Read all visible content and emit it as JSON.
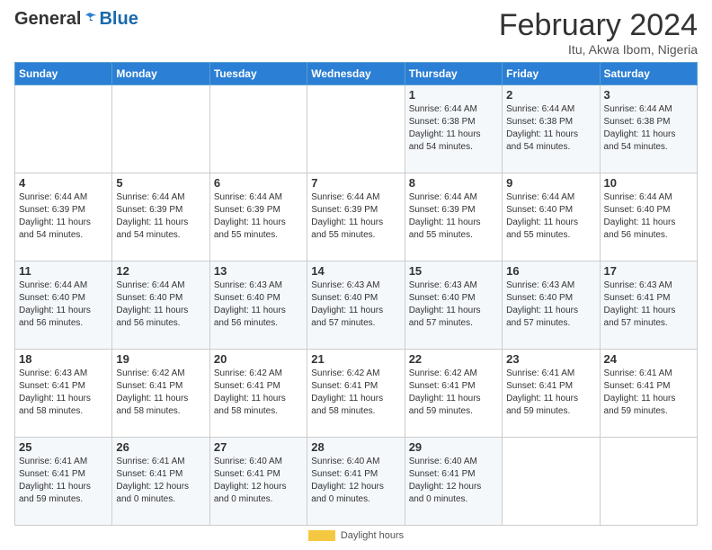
{
  "header": {
    "logo_general": "General",
    "logo_blue": "Blue",
    "month_title": "February 2024",
    "subtitle": "Itu, Akwa Ibom, Nigeria"
  },
  "days_of_week": [
    "Sunday",
    "Monday",
    "Tuesday",
    "Wednesday",
    "Thursday",
    "Friday",
    "Saturday"
  ],
  "weeks": [
    [
      {
        "day": "",
        "info": ""
      },
      {
        "day": "",
        "info": ""
      },
      {
        "day": "",
        "info": ""
      },
      {
        "day": "",
        "info": ""
      },
      {
        "day": "1",
        "info": "Sunrise: 6:44 AM\nSunset: 6:38 PM\nDaylight: 11 hours\nand 54 minutes."
      },
      {
        "day": "2",
        "info": "Sunrise: 6:44 AM\nSunset: 6:38 PM\nDaylight: 11 hours\nand 54 minutes."
      },
      {
        "day": "3",
        "info": "Sunrise: 6:44 AM\nSunset: 6:38 PM\nDaylight: 11 hours\nand 54 minutes."
      }
    ],
    [
      {
        "day": "4",
        "info": "Sunrise: 6:44 AM\nSunset: 6:39 PM\nDaylight: 11 hours\nand 54 minutes."
      },
      {
        "day": "5",
        "info": "Sunrise: 6:44 AM\nSunset: 6:39 PM\nDaylight: 11 hours\nand 54 minutes."
      },
      {
        "day": "6",
        "info": "Sunrise: 6:44 AM\nSunset: 6:39 PM\nDaylight: 11 hours\nand 55 minutes."
      },
      {
        "day": "7",
        "info": "Sunrise: 6:44 AM\nSunset: 6:39 PM\nDaylight: 11 hours\nand 55 minutes."
      },
      {
        "day": "8",
        "info": "Sunrise: 6:44 AM\nSunset: 6:39 PM\nDaylight: 11 hours\nand 55 minutes."
      },
      {
        "day": "9",
        "info": "Sunrise: 6:44 AM\nSunset: 6:40 PM\nDaylight: 11 hours\nand 55 minutes."
      },
      {
        "day": "10",
        "info": "Sunrise: 6:44 AM\nSunset: 6:40 PM\nDaylight: 11 hours\nand 56 minutes."
      }
    ],
    [
      {
        "day": "11",
        "info": "Sunrise: 6:44 AM\nSunset: 6:40 PM\nDaylight: 11 hours\nand 56 minutes."
      },
      {
        "day": "12",
        "info": "Sunrise: 6:44 AM\nSunset: 6:40 PM\nDaylight: 11 hours\nand 56 minutes."
      },
      {
        "day": "13",
        "info": "Sunrise: 6:43 AM\nSunset: 6:40 PM\nDaylight: 11 hours\nand 56 minutes."
      },
      {
        "day": "14",
        "info": "Sunrise: 6:43 AM\nSunset: 6:40 PM\nDaylight: 11 hours\nand 57 minutes."
      },
      {
        "day": "15",
        "info": "Sunrise: 6:43 AM\nSunset: 6:40 PM\nDaylight: 11 hours\nand 57 minutes."
      },
      {
        "day": "16",
        "info": "Sunrise: 6:43 AM\nSunset: 6:40 PM\nDaylight: 11 hours\nand 57 minutes."
      },
      {
        "day": "17",
        "info": "Sunrise: 6:43 AM\nSunset: 6:41 PM\nDaylight: 11 hours\nand 57 minutes."
      }
    ],
    [
      {
        "day": "18",
        "info": "Sunrise: 6:43 AM\nSunset: 6:41 PM\nDaylight: 11 hours\nand 58 minutes."
      },
      {
        "day": "19",
        "info": "Sunrise: 6:42 AM\nSunset: 6:41 PM\nDaylight: 11 hours\nand 58 minutes."
      },
      {
        "day": "20",
        "info": "Sunrise: 6:42 AM\nSunset: 6:41 PM\nDaylight: 11 hours\nand 58 minutes."
      },
      {
        "day": "21",
        "info": "Sunrise: 6:42 AM\nSunset: 6:41 PM\nDaylight: 11 hours\nand 58 minutes."
      },
      {
        "day": "22",
        "info": "Sunrise: 6:42 AM\nSunset: 6:41 PM\nDaylight: 11 hours\nand 59 minutes."
      },
      {
        "day": "23",
        "info": "Sunrise: 6:41 AM\nSunset: 6:41 PM\nDaylight: 11 hours\nand 59 minutes."
      },
      {
        "day": "24",
        "info": "Sunrise: 6:41 AM\nSunset: 6:41 PM\nDaylight: 11 hours\nand 59 minutes."
      }
    ],
    [
      {
        "day": "25",
        "info": "Sunrise: 6:41 AM\nSunset: 6:41 PM\nDaylight: 11 hours\nand 59 minutes."
      },
      {
        "day": "26",
        "info": "Sunrise: 6:41 AM\nSunset: 6:41 PM\nDaylight: 12 hours\nand 0 minutes."
      },
      {
        "day": "27",
        "info": "Sunrise: 6:40 AM\nSunset: 6:41 PM\nDaylight: 12 hours\nand 0 minutes."
      },
      {
        "day": "28",
        "info": "Sunrise: 6:40 AM\nSunset: 6:41 PM\nDaylight: 12 hours\nand 0 minutes."
      },
      {
        "day": "29",
        "info": "Sunrise: 6:40 AM\nSunset: 6:41 PM\nDaylight: 12 hours\nand 0 minutes."
      },
      {
        "day": "",
        "info": ""
      },
      {
        "day": "",
        "info": ""
      }
    ]
  ],
  "footer": {
    "daylight_label": "Daylight hours"
  }
}
